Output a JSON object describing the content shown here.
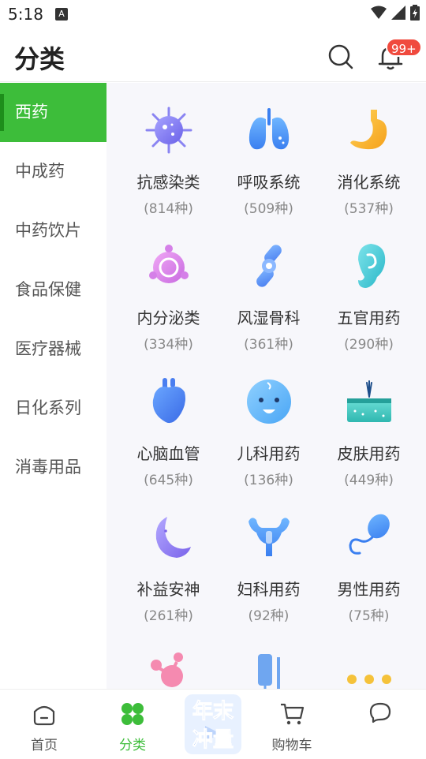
{
  "status": {
    "time": "5:18",
    "notif_glyph": "A"
  },
  "header": {
    "title": "分类",
    "badge": "99+"
  },
  "sidebar": {
    "items": [
      {
        "label": "西药",
        "active": true
      },
      {
        "label": "中成药"
      },
      {
        "label": "中药饮片"
      },
      {
        "label": "食品保健"
      },
      {
        "label": "医疗器械"
      },
      {
        "label": "日化系列"
      },
      {
        "label": "消毒用品"
      }
    ]
  },
  "categories": [
    {
      "name": "抗感染类",
      "count": "(814种)",
      "icon": "virus-icon"
    },
    {
      "name": "呼吸系统",
      "count": "(509种)",
      "icon": "lungs-icon"
    },
    {
      "name": "消化系统",
      "count": "(537种)",
      "icon": "stomach-icon"
    },
    {
      "name": "内分泌类",
      "count": "(334种)",
      "icon": "endocrine-icon"
    },
    {
      "name": "风湿骨科",
      "count": "(361种)",
      "icon": "bone-joint-icon"
    },
    {
      "name": "五官用药",
      "count": "(290种)",
      "icon": "ear-icon"
    },
    {
      "name": "心脑血管",
      "count": "(645种)",
      "icon": "heart-icon"
    },
    {
      "name": "儿科用药",
      "count": "(136种)",
      "icon": "baby-icon"
    },
    {
      "name": "皮肤用药",
      "count": "(449种)",
      "icon": "skin-icon"
    },
    {
      "name": "补益安神",
      "count": "(261种)",
      "icon": "moon-icon"
    },
    {
      "name": "妇科用药",
      "count": "(92种)",
      "icon": "uterus-icon"
    },
    {
      "name": "男性用药",
      "count": "(75种)",
      "icon": "sperm-icon"
    }
  ],
  "partial_row_icons": [
    "molecule-icon",
    "iv-drip-icon",
    "more-dots-icon"
  ],
  "tabbar": {
    "home": "首页",
    "category": "分类",
    "promo_text_1": "年末",
    "promo_text_2": "冲量",
    "cart": "购物车"
  },
  "colors": {
    "accent": "#3dbd3a",
    "badge": "#f04a3e"
  }
}
